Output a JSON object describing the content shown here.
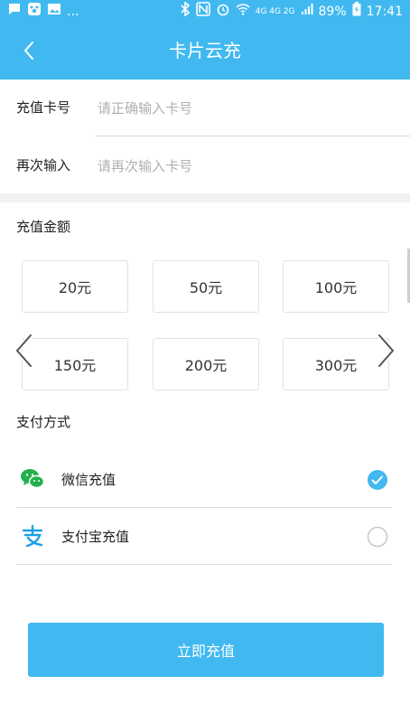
{
  "statusbar": {
    "dots": "...",
    "network": "4G 4G 2G",
    "battery": "89%",
    "time": "17:41"
  },
  "nav": {
    "title": "卡片云充"
  },
  "form": {
    "card_label": "充值卡号",
    "card_placeholder": "请正确输入卡号",
    "repeat_label": "再次输入",
    "repeat_placeholder": "请再次输入卡号"
  },
  "amount": {
    "title": "充值金额",
    "options": [
      "20元",
      "50元",
      "100元",
      "150元",
      "200元",
      "300元"
    ]
  },
  "payment": {
    "title": "支付方式",
    "methods": [
      {
        "label": "微信充值",
        "selected": true
      },
      {
        "label": "支付宝充值",
        "selected": false
      }
    ]
  },
  "submit": {
    "label": "立即充值"
  },
  "colors": {
    "primary": "#41b9f0",
    "wechat": "#22b14c",
    "alipay": "#1aa1e5"
  }
}
